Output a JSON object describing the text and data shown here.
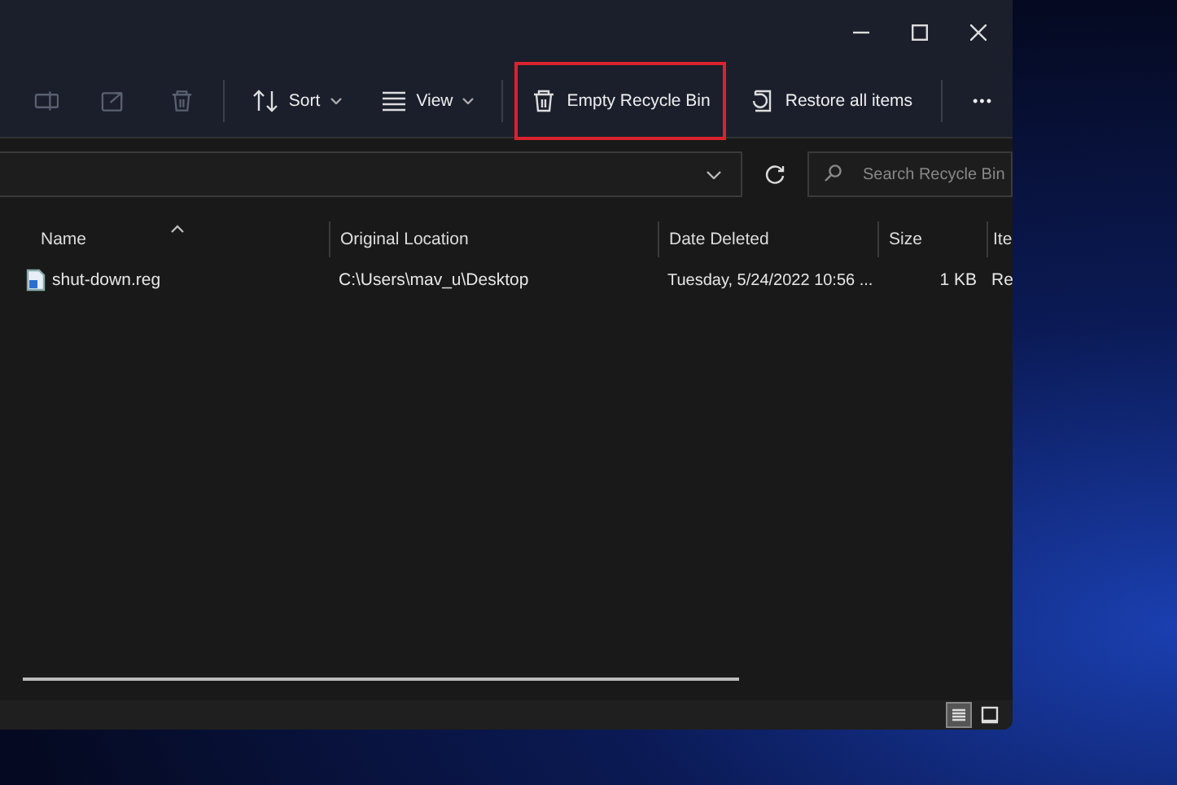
{
  "toolbar": {
    "icon_buttons": [
      {
        "kind": "rename",
        "disabled": true
      },
      {
        "kind": "share",
        "disabled": true
      },
      {
        "kind": "delete",
        "disabled": true
      }
    ],
    "buttons": [
      {
        "kind": "sort",
        "label": "Sort",
        "dropdown": true,
        "highlighted": false
      },
      {
        "kind": "view",
        "label": "View",
        "dropdown": true,
        "highlighted": false
      },
      {
        "kind": "empty",
        "label": "Empty Recycle Bin",
        "dropdown": false,
        "highlighted": true
      },
      {
        "kind": "restore",
        "label": "Restore all items",
        "dropdown": false,
        "highlighted": false
      }
    ],
    "more": "•••"
  },
  "search": {
    "placeholder": "Search Recycle Bin"
  },
  "table": {
    "columns": [
      {
        "label": "Name",
        "sorted": true
      },
      {
        "label": "Original Location",
        "sorted": false
      },
      {
        "label": "Date Deleted",
        "sorted": false
      },
      {
        "label": "Size",
        "sorted": false
      },
      {
        "label": "Ite",
        "sorted": false
      }
    ],
    "rows": [
      {
        "cells": [
          "shut-down.reg",
          "C:\\Users\\mav_u\\Desktop",
          "Tuesday, 5/24/2022 10:56 ...",
          "1 KB",
          "Re"
        ]
      }
    ]
  },
  "status_bar": {
    "views": [
      {
        "kind": "details",
        "selected": true
      },
      {
        "kind": "tiles",
        "selected": false
      }
    ]
  }
}
